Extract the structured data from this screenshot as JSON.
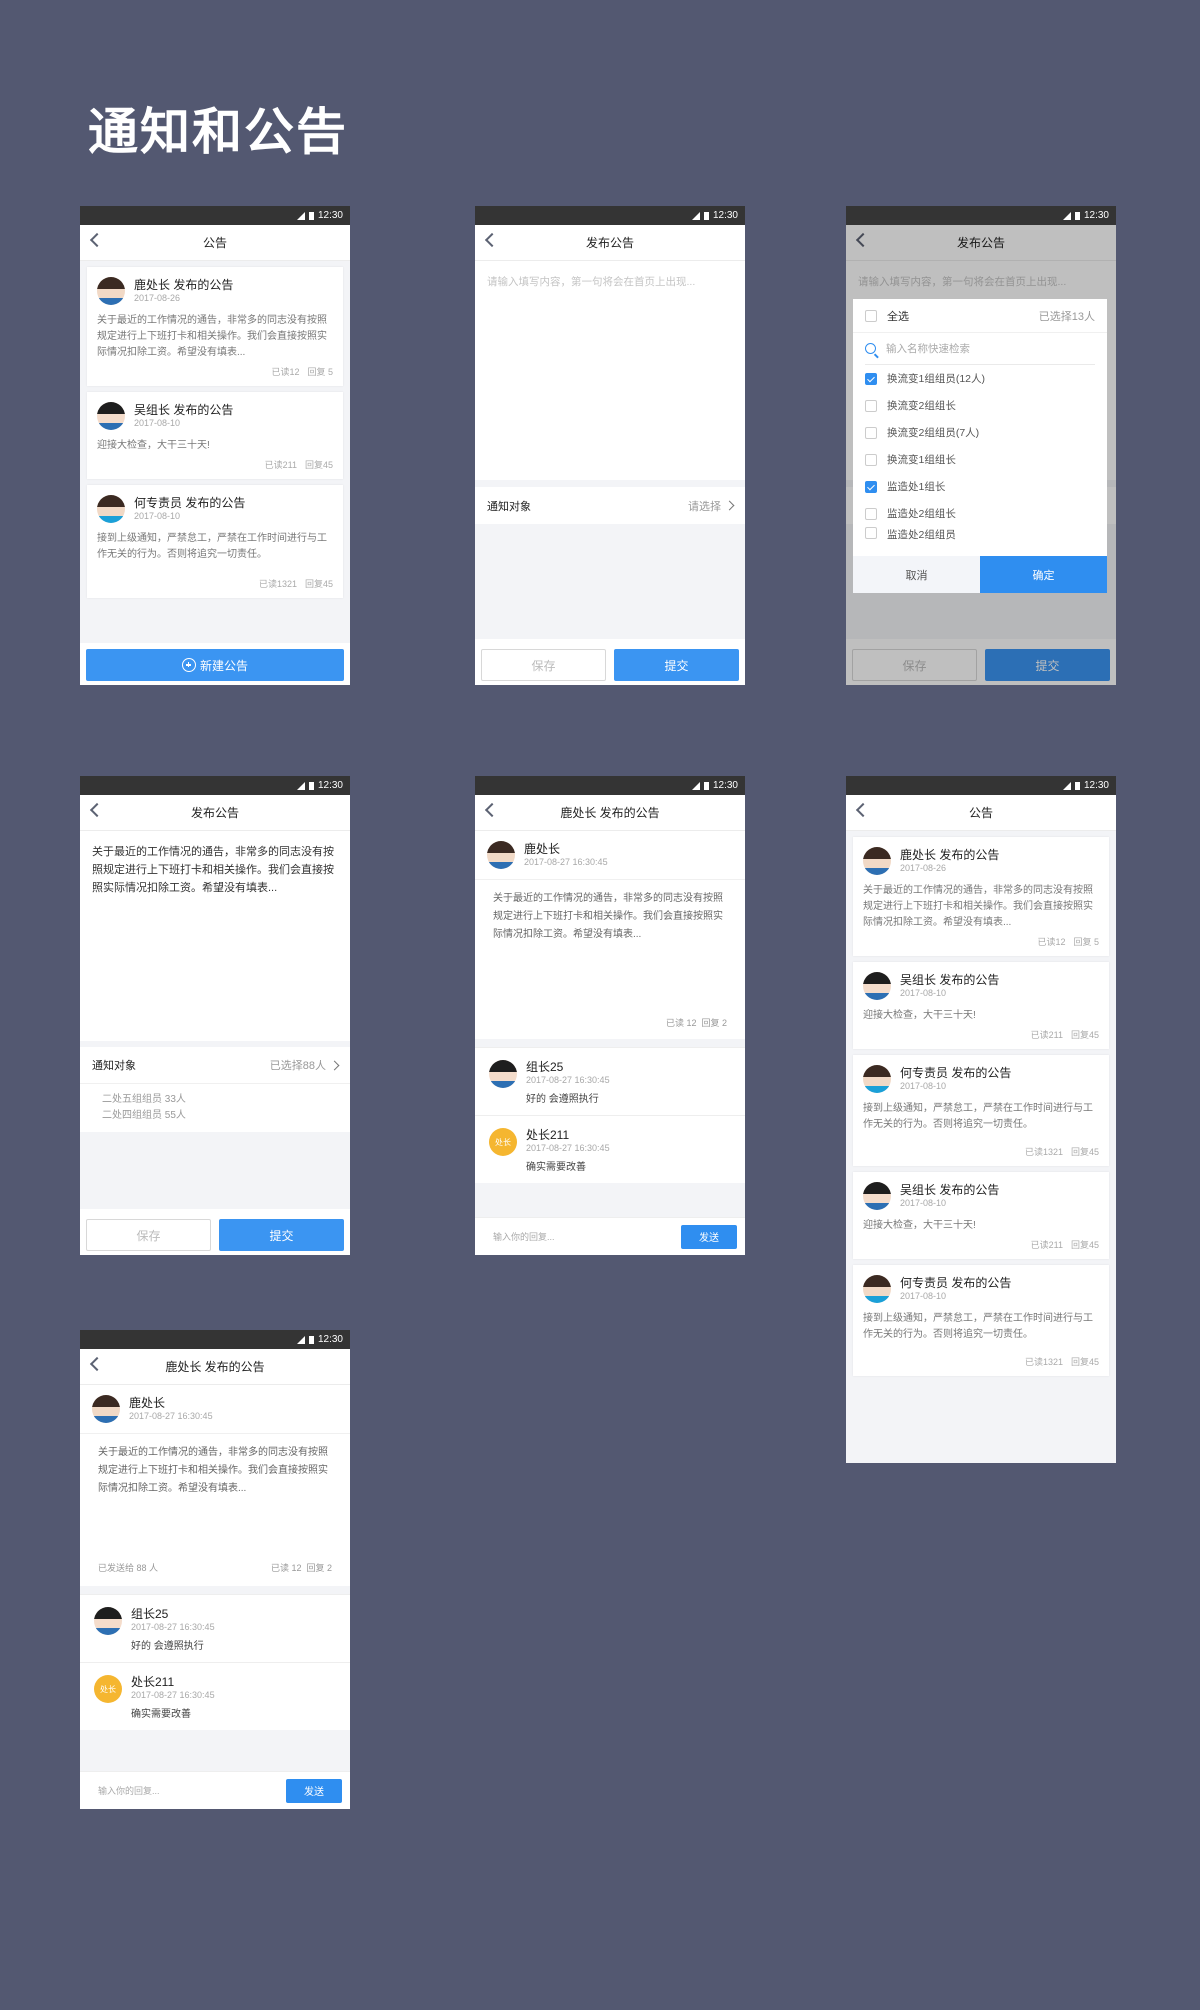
{
  "page_title": "通知和公告",
  "status_time": "12:30",
  "list": {
    "title": "公告",
    "cards": [
      {
        "name": "鹿处长 发布的公告",
        "date": "2017-08-26",
        "body": "关于最近的工作情况的通告，非常多的同志没有按照规定进行上下班打卡和相关操作。我们会直接按照实际情况扣除工资。希望没有填表...",
        "read": "已读12",
        "reply": "回复 5"
      },
      {
        "name": "吴组长 发布的公告",
        "date": "2017-08-10",
        "body": "迎接大检查，大干三十天!",
        "read": "已读211",
        "reply": "回复45"
      },
      {
        "name": "何专责员 发布的公告",
        "date": "2017-08-10",
        "body": "接到上级通知，严禁怠工，严禁在工作时间进行与工作无关的行为。否则将追究一切责任。",
        "read": "已读1321",
        "reply": "回复45"
      }
    ],
    "new_button": "新建公告"
  },
  "publish": {
    "title": "发布公告",
    "placeholder": "请输入填写内容，第一句将会在首页上出现...",
    "target_label": "通知对象",
    "target_value": "请选择",
    "save": "保存",
    "submit": "提交"
  },
  "picker": {
    "title": "发布公告",
    "placeholder": "请输入填写内容，第一句将会在首页上出现...",
    "select_all": "全选",
    "selected": "已选择13人",
    "search_placeholder": "输入名称快速检索",
    "options": [
      {
        "label": "换流变1组组员(12人)",
        "checked": true
      },
      {
        "label": "换流变2组组长",
        "checked": false
      },
      {
        "label": "换流变2组组员(7人)",
        "checked": false
      },
      {
        "label": "换流变1组组长",
        "checked": false
      },
      {
        "label": "监造处1组长",
        "checked": true
      },
      {
        "label": "监造处2组组长",
        "checked": false
      },
      {
        "label": "监造处2组组员",
        "checked": false
      }
    ],
    "cancel": "取消",
    "confirm": "确定",
    "save": "保存",
    "submit": "提交"
  },
  "filled": {
    "title": "发布公告",
    "content": "关于最近的工作情况的通告，非常多的同志没有按照规定进行上下班打卡和相关操作。我们会直接按照实际情况扣除工资。希望没有填表...",
    "target_label": "通知对象",
    "target_value": "已选择88人",
    "groups": [
      "二处五组组员 33人",
      "二处四组组员 55人"
    ],
    "save": "保存",
    "submit": "提交"
  },
  "detail": {
    "title": "鹿处长 发布的公告",
    "author": "鹿处长",
    "time": "2017-08-27 16:30:45",
    "body": "关于最近的工作情况的通告，非常多的同志没有按照规定进行上下班打卡和相关操作。我们会直接按照实际情况扣除工资。希望没有填表...",
    "read": "已读 12",
    "reply": "回复 2",
    "replies": [
      {
        "name": "组长25",
        "time": "2017-08-27 16:30:45",
        "text": "好的 会遵照执行"
      },
      {
        "name": "处长211",
        "time": "2017-08-27 16:30:45",
        "text": "确实需要改善",
        "badge": "处长"
      }
    ],
    "input_placeholder": "输入你的回复...",
    "send": "发送"
  },
  "list2": {
    "title": "公告",
    "cards": [
      {
        "name": "鹿处长 发布的公告",
        "date": "2017-08-26",
        "body": "关于最近的工作情况的通告，非常多的同志没有按照规定进行上下班打卡和相关操作。我们会直接按照实际情况扣除工资。希望没有填表...",
        "read": "已读12",
        "reply": "回复 5"
      },
      {
        "name": "吴组长 发布的公告",
        "date": "2017-08-10",
        "body": "迎接大检查，大干三十天!",
        "read": "已读211",
        "reply": "回复45"
      },
      {
        "name": "何专责员 发布的公告",
        "date": "2017-08-10",
        "body": "接到上级通知，严禁怠工，严禁在工作时间进行与工作无关的行为。否则将追究一切责任。",
        "read": "已读1321",
        "reply": "回复45"
      },
      {
        "name": "吴组长 发布的公告",
        "date": "2017-08-10",
        "body": "迎接大检查，大干三十天!",
        "read": "已读211",
        "reply": "回复45"
      },
      {
        "name": "何专责员 发布的公告",
        "date": "2017-08-10",
        "body": "接到上级通知，严禁怠工，严禁在工作时间进行与工作无关的行为。否则将追究一切责任。",
        "read": "已读1321",
        "reply": "回复45"
      }
    ]
  },
  "detail2": {
    "title": "鹿处长 发布的公告",
    "author": "鹿处长",
    "time": "2017-08-27 16:30:45",
    "body": "关于最近的工作情况的通告，非常多的同志没有按照规定进行上下班打卡和相关操作。我们会直接按照实际情况扣除工资。希望没有填表...",
    "sent_to": "已发送给 88 人",
    "read": "已读 12",
    "reply": "回复 2",
    "replies": [
      {
        "name": "组长25",
        "time": "2017-08-27 16:30:45",
        "text": "好的 会遵照执行"
      },
      {
        "name": "处长211",
        "time": "2017-08-27 16:30:45",
        "text": "确实需要改善",
        "badge": "处长"
      }
    ],
    "input_placeholder": "输入你的回复...",
    "send": "发送"
  }
}
